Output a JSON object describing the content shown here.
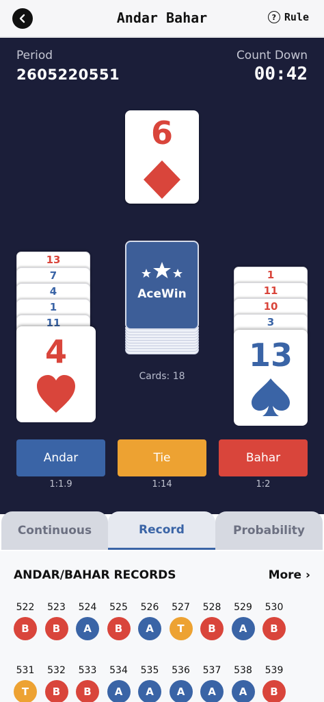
{
  "header": {
    "title": "Andar Bahar",
    "rule_label": "Rule",
    "rule_icon": "?"
  },
  "period": {
    "label": "Period",
    "value": "2605220551"
  },
  "countdown": {
    "label": "Count Down",
    "value": "00:42"
  },
  "joker_card": {
    "rank": "6",
    "suit": "diamond",
    "color": "red"
  },
  "andar_stack": [
    {
      "rank": "13",
      "color": "red"
    },
    {
      "rank": "7",
      "color": "blue"
    },
    {
      "rank": "4",
      "color": "blue"
    },
    {
      "rank": "1",
      "color": "blue"
    },
    {
      "rank": "11",
      "color": "blue"
    }
  ],
  "andar_top_card": {
    "rank": "4",
    "suit": "heart",
    "color": "red"
  },
  "bahar_stack": [
    {
      "rank": "1",
      "color": "red"
    },
    {
      "rank": "11",
      "color": "red"
    },
    {
      "rank": "10",
      "color": "red"
    },
    {
      "rank": "3",
      "color": "blue"
    }
  ],
  "bahar_top_card": {
    "rank": "13",
    "suit": "spade",
    "color": "blue"
  },
  "deck": {
    "brand": "AceWin",
    "cards_label": "Cards: 18"
  },
  "bets": [
    {
      "label": "Andar",
      "odds": "1:1.9",
      "color": "#3a64a6"
    },
    {
      "label": "Tie",
      "odds": "1:14",
      "color": "#eda232"
    },
    {
      "label": "Bahar",
      "odds": "1:2",
      "color": "#d9453b"
    }
  ],
  "tabs": [
    {
      "label": "Continuous",
      "active": false
    },
    {
      "label": "Record",
      "active": true
    },
    {
      "label": "Probability",
      "active": false
    }
  ],
  "records": {
    "title": "ANDAR/BAHAR RECORDS",
    "more_label": "More ›",
    "colors": {
      "A": "#3a64a6",
      "B": "#d9453b",
      "T": "#eda232"
    },
    "rows": [
      [
        {
          "n": "522",
          "r": "B"
        },
        {
          "n": "523",
          "r": "B"
        },
        {
          "n": "524",
          "r": "A"
        },
        {
          "n": "525",
          "r": "B"
        },
        {
          "n": "526",
          "r": "A"
        },
        {
          "n": "527",
          "r": "T"
        },
        {
          "n": "528",
          "r": "B"
        },
        {
          "n": "529",
          "r": "A"
        },
        {
          "n": "530",
          "r": "B"
        }
      ],
      [
        {
          "n": "531",
          "r": "T"
        },
        {
          "n": "532",
          "r": "B"
        },
        {
          "n": "533",
          "r": "B"
        },
        {
          "n": "534",
          "r": "A"
        },
        {
          "n": "535",
          "r": "A"
        },
        {
          "n": "536",
          "r": "A"
        },
        {
          "n": "537",
          "r": "A"
        },
        {
          "n": "538",
          "r": "A"
        },
        {
          "n": "539",
          "r": "B"
        }
      ]
    ]
  },
  "colors": {
    "board_bg": "#1b1e39",
    "red": "#d9453b",
    "blue": "#3a64a6",
    "orange": "#eda232"
  }
}
